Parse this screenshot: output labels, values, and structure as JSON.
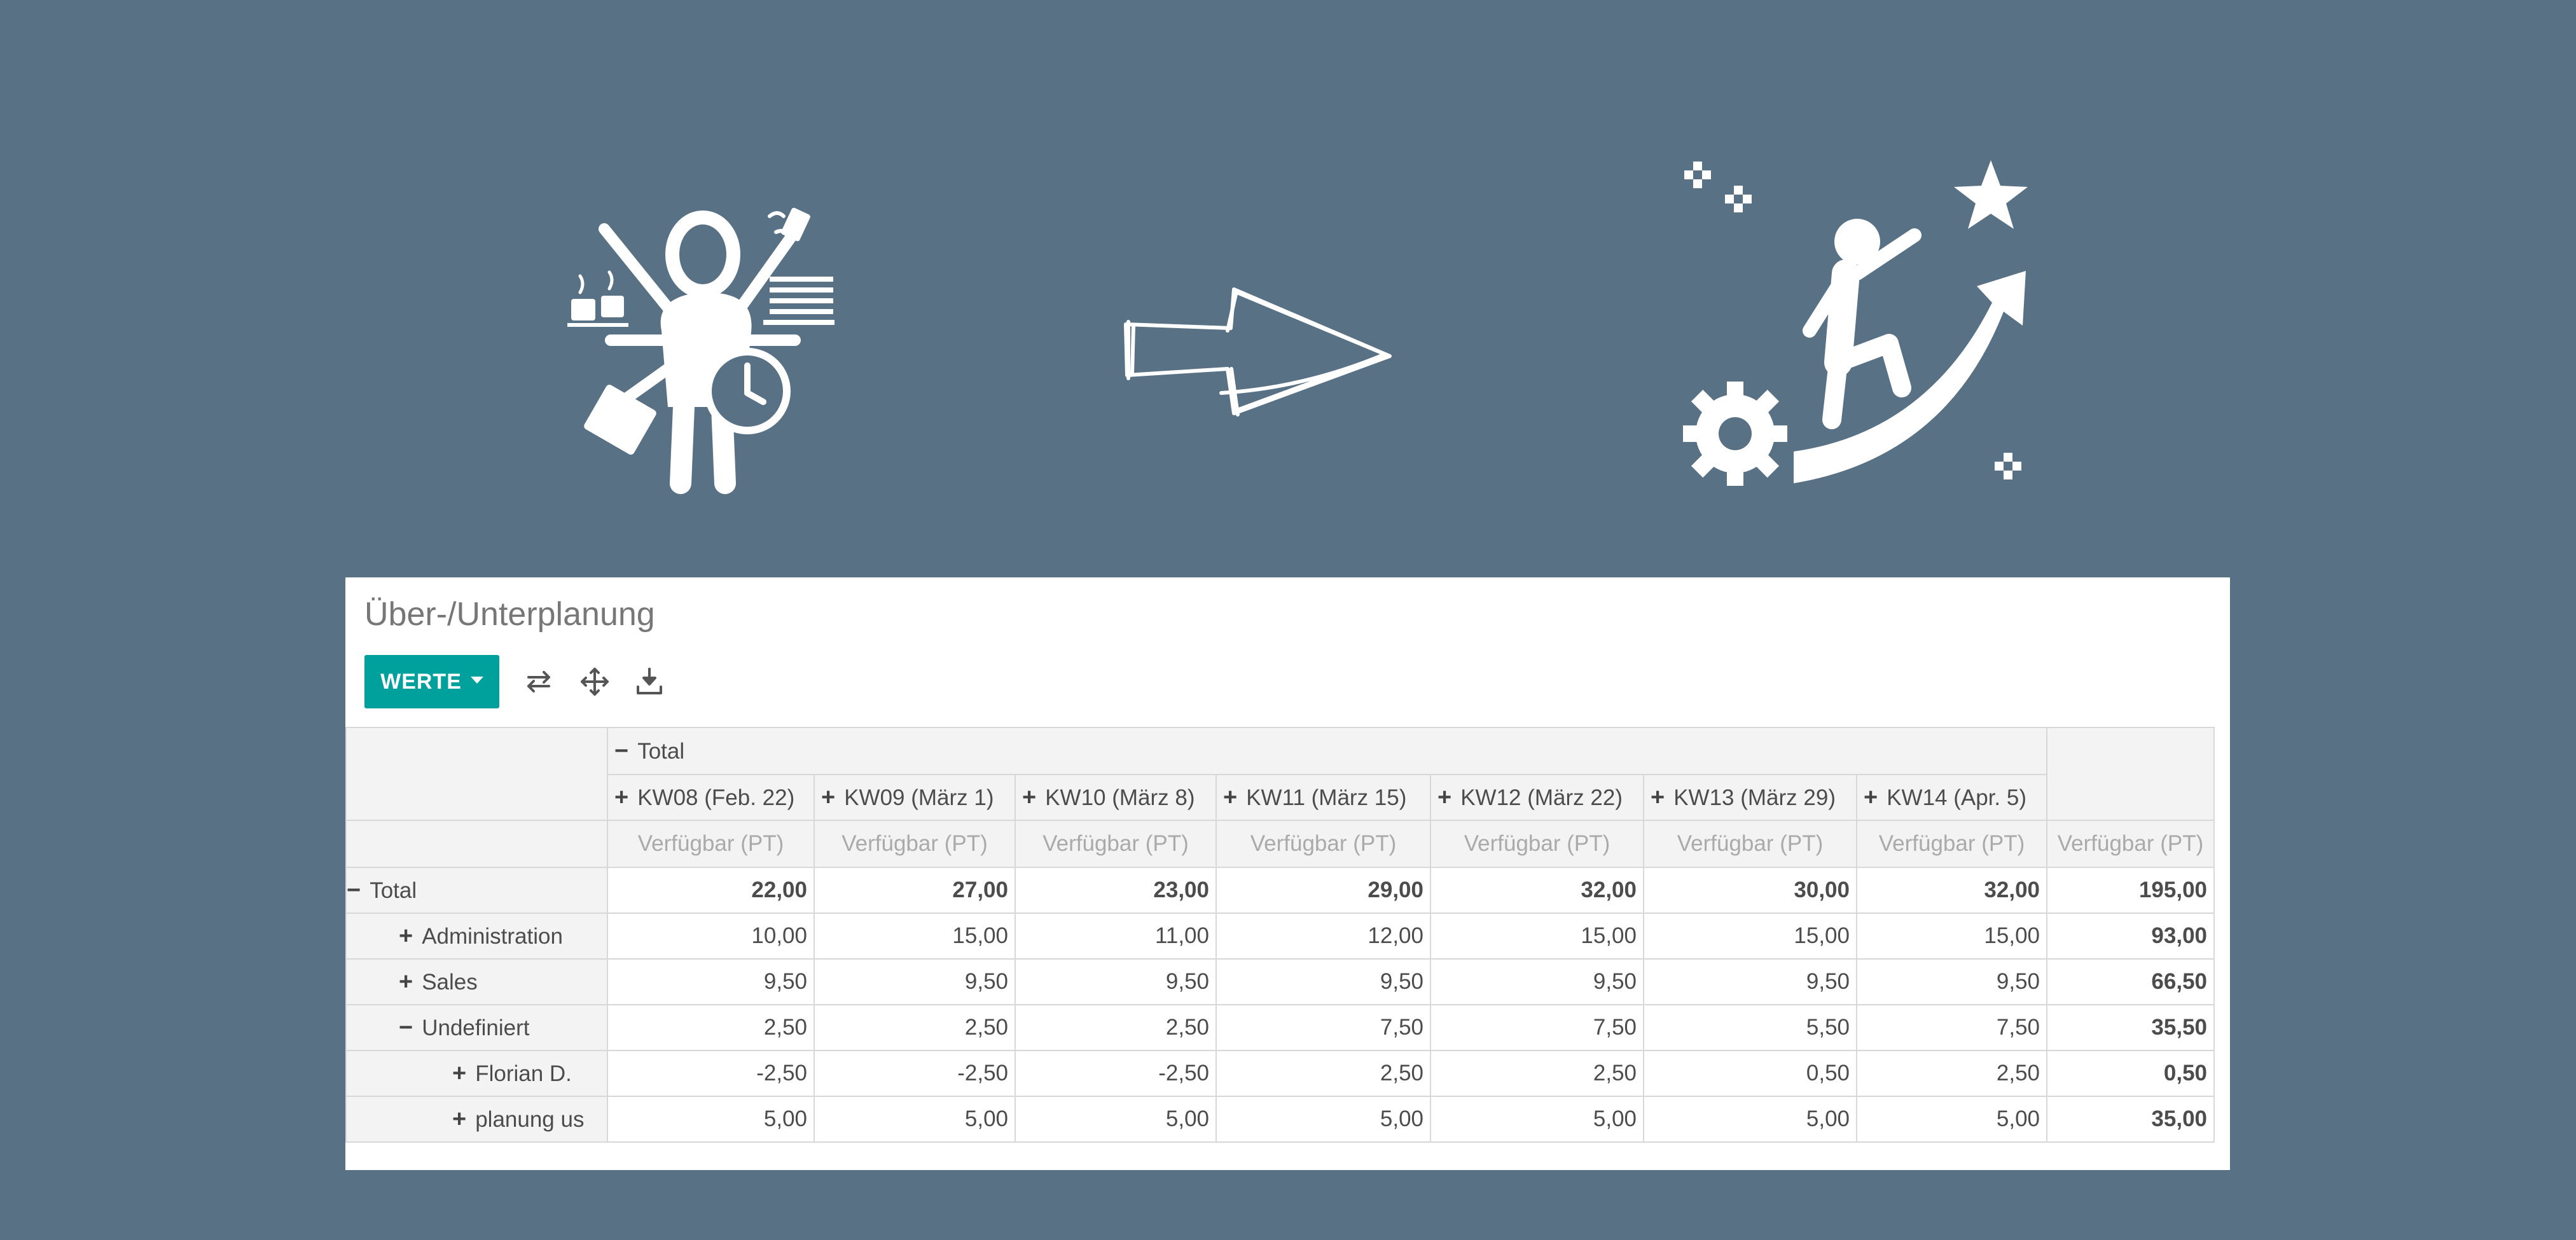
{
  "report": {
    "title": "Über-/Unterplanung",
    "measures_button": "WERTE",
    "col_group_label": "Total",
    "measure_label": "Verfügbar (PT)",
    "weeks": [
      "KW08 (Feb. 22)",
      "KW09 (März 1)",
      "KW10 (März 8)",
      "KW11 (März 15)",
      "KW12 (März 22)",
      "KW13 (März 29)",
      "KW14 (Apr. 5)"
    ],
    "rows": [
      {
        "label": "Total",
        "expanded": true,
        "level": 0,
        "values": [
          "22,00",
          "27,00",
          "23,00",
          "29,00",
          "32,00",
          "30,00",
          "32,00"
        ],
        "total": "195,00"
      },
      {
        "label": "Administration",
        "expanded": false,
        "level": 1,
        "values": [
          "10,00",
          "15,00",
          "11,00",
          "12,00",
          "15,00",
          "15,00",
          "15,00"
        ],
        "total": "93,00"
      },
      {
        "label": "Sales",
        "expanded": false,
        "level": 1,
        "values": [
          "9,50",
          "9,50",
          "9,50",
          "9,50",
          "9,50",
          "9,50",
          "9,50"
        ],
        "total": "66,50"
      },
      {
        "label": "Undefiniert",
        "expanded": true,
        "level": 1,
        "values": [
          "2,50",
          "2,50",
          "2,50",
          "7,50",
          "7,50",
          "5,50",
          "7,50"
        ],
        "total": "35,50"
      },
      {
        "label": "Florian D.",
        "expanded": false,
        "level": 2,
        "values": [
          "-2,50",
          "-2,50",
          "-2,50",
          "2,50",
          "2,50",
          "0,50",
          "2,50"
        ],
        "total": "0,50"
      },
      {
        "label": "planung us",
        "expanded": false,
        "level": 2,
        "values": [
          "5,00",
          "5,00",
          "5,00",
          "5,00",
          "5,00",
          "5,00",
          "5,00"
        ],
        "total": "35,00"
      }
    ]
  },
  "icons": {
    "flip": "flip-axis-icon",
    "expand": "expand-all-icon",
    "download": "download-icon",
    "illustration_left": "overwhelmed-person-icon",
    "illustration_arrow": "hand-drawn-arrow-icon",
    "illustration_right": "success-climber-icon"
  },
  "colors": {
    "background": "#587185",
    "accent": "#00a09d"
  }
}
